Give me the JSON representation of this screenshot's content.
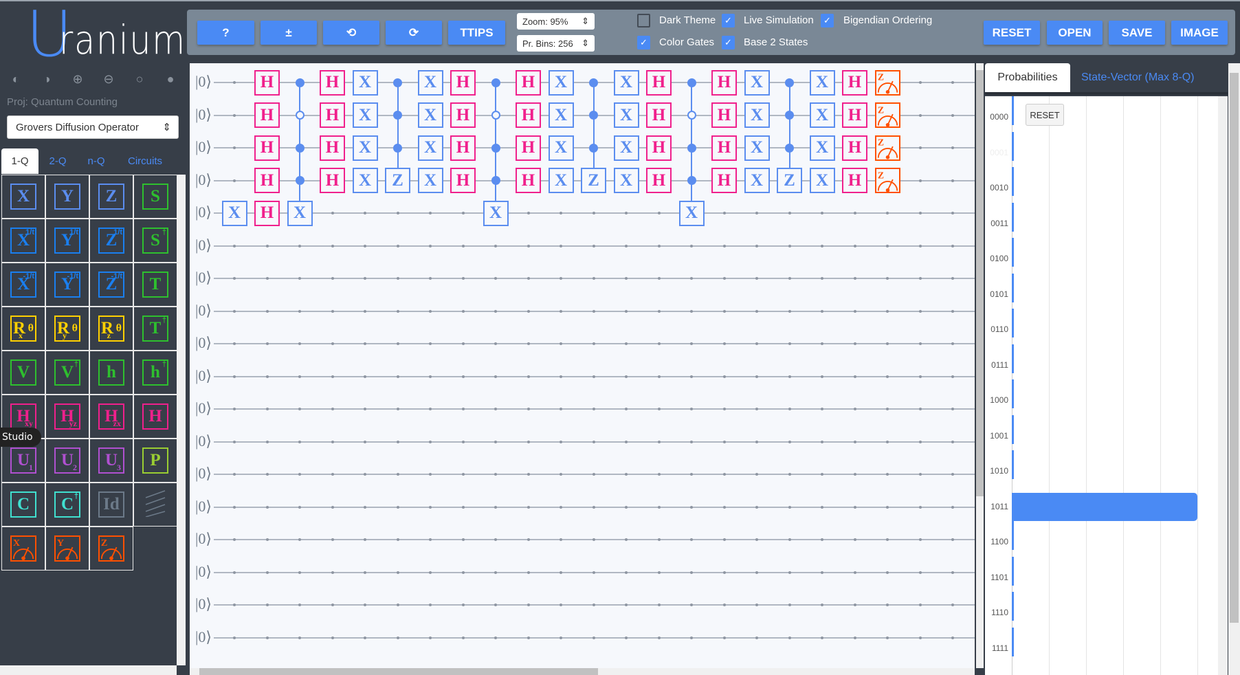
{
  "app": {
    "logo_text": "Uranium",
    "project_label": "Proj: Quantum Counting",
    "circuit_select": "Grovers Diffusion Operator",
    "tooltip": "Studio",
    "mode_icons": [
      "half-circle-left-icon",
      "half-circle-right-icon",
      "circle-plus-icon",
      "circle-minus-icon",
      "circle-empty-icon",
      "circle-filled-icon"
    ]
  },
  "sidebar": {
    "tabs": [
      {
        "label": "1-Q",
        "active": true
      },
      {
        "label": "2-Q"
      },
      {
        "label": "n-Q"
      },
      {
        "label": "Circuits"
      }
    ],
    "palette": [
      {
        "t": "X",
        "c": "#5b8def"
      },
      {
        "t": "Y",
        "c": "#5b8def"
      },
      {
        "t": "Z",
        "c": "#5b8def"
      },
      {
        "t": "S",
        "c": "#2ec02e"
      },
      {
        "t": "X",
        "sup": "1/t",
        "c": "#1a7ff0"
      },
      {
        "t": "Y",
        "sup": "1/t",
        "c": "#1a7ff0"
      },
      {
        "t": "Z",
        "sup": "1/t",
        "c": "#1a7ff0"
      },
      {
        "t": "S",
        "sup": "†",
        "c": "#2ec02e"
      },
      {
        "t": "X",
        "sup": "-1/t",
        "c": "#1a7ff0"
      },
      {
        "t": "Y",
        "sup": "-1/t",
        "c": "#1a7ff0"
      },
      {
        "t": "Z",
        "sup": "-1/t",
        "c": "#1a7ff0"
      },
      {
        "t": "T",
        "c": "#2ec02e"
      },
      {
        "t": "Rθ",
        "sub": "x",
        "c": "#ffd000"
      },
      {
        "t": "Rθ",
        "sub": "y",
        "c": "#ffd000"
      },
      {
        "t": "Rθ",
        "sub": "z",
        "c": "#ffd000"
      },
      {
        "t": "T",
        "sup": "†",
        "c": "#2ec02e"
      },
      {
        "t": "V",
        "c": "#2ec02e"
      },
      {
        "t": "V",
        "sup": "†",
        "c": "#2ec02e"
      },
      {
        "t": "h",
        "c": "#2ec02e"
      },
      {
        "t": "h",
        "sup": "†",
        "c": "#2ec02e"
      },
      {
        "t": "H",
        "sub": "xy",
        "c": "#f0208c"
      },
      {
        "t": "H",
        "sub": "yz",
        "c": "#f0208c"
      },
      {
        "t": "H",
        "sub": "zx",
        "c": "#f0208c"
      },
      {
        "t": "H",
        "c": "#f0208c"
      },
      {
        "t": "U",
        "sub": "1",
        "c": "#b050d0"
      },
      {
        "t": "U",
        "sub": "2",
        "c": "#b050d0"
      },
      {
        "t": "U",
        "sub": "3",
        "c": "#b050d0"
      },
      {
        "t": "P",
        "c": "#9acd32"
      },
      {
        "t": "C",
        "c": "#40e0d0"
      },
      {
        "t": "C",
        "sup": "†",
        "c": "#40e0d0"
      },
      {
        "t": "Id",
        "c": "#6c7a89"
      },
      {
        "icon": "barrier-icon",
        "c": "#6c7a89"
      },
      {
        "meas": "X",
        "c": "#ff5000"
      },
      {
        "meas": "Y",
        "c": "#ff5000"
      },
      {
        "meas": "Z",
        "c": "#ff5000"
      }
    ]
  },
  "toolbar": {
    "help": "?",
    "plusminus": "±",
    "undo": "⟲",
    "redo": "⟳",
    "ttips": "TTIPS",
    "zoom": "Zoom: 95%",
    "bins": "Pr. Bins: 256",
    "checks": [
      {
        "label": "Dark Theme",
        "checked": false
      },
      {
        "label": "Live Simulation",
        "checked": true
      },
      {
        "label": "Bigendian Ordering",
        "checked": true
      },
      {
        "label": "Color Gates",
        "checked": true
      },
      {
        "label": "Base 2 States",
        "checked": true
      }
    ],
    "reset": "RESET",
    "open": "OPEN",
    "save": "SAVE",
    "image": "IMAGE"
  },
  "circuit": {
    "ket": "|0⟩",
    "qubits": 18,
    "columns_total": 23,
    "colors": {
      "H": "#f0208c",
      "X": "#5b8def",
      "Z": "#5b8def",
      "M": "#ff5000"
    },
    "columns": [
      [
        null,
        null,
        null,
        null,
        "X"
      ],
      [
        "H",
        "H",
        "H",
        "H",
        "H"
      ],
      [
        "●",
        "○",
        "●",
        "●",
        "X"
      ],
      [
        "H",
        "H",
        "H",
        "H"
      ],
      [
        "X",
        "X",
        "X",
        "X"
      ],
      [
        "●",
        "●",
        "●",
        "Z"
      ],
      [
        "X",
        "X",
        "X",
        "X"
      ],
      [
        "H",
        "H",
        "H",
        "H"
      ],
      [
        "●",
        "○",
        "●",
        "●",
        "X"
      ],
      [
        "H",
        "H",
        "H",
        "H"
      ],
      [
        "X",
        "X",
        "X",
        "X"
      ],
      [
        "●",
        "●",
        "●",
        "Z"
      ],
      [
        "X",
        "X",
        "X",
        "X"
      ],
      [
        "H",
        "H",
        "H",
        "H"
      ],
      [
        "●",
        "○",
        "●",
        "●",
        "X"
      ],
      [
        "H",
        "H",
        "H",
        "H"
      ],
      [
        "X",
        "X",
        "X",
        "X"
      ],
      [
        "●",
        "●",
        "●",
        "Z"
      ],
      [
        "X",
        "X",
        "X",
        "X"
      ],
      [
        "H",
        "H",
        "H",
        "H"
      ],
      [
        "MZ",
        "MZ",
        "MZ",
        "MZ"
      ]
    ]
  },
  "results": {
    "tabs": [
      "Probabilities",
      "State-Vector (Max 8-Q)"
    ],
    "reset": "RESET",
    "chart_data": {
      "type": "bar",
      "orientation": "horizontal",
      "categories": [
        "0000",
        "0001",
        "0010",
        "0011",
        "0100",
        "0101",
        "0110",
        "0111",
        "1000",
        "1001",
        "1010",
        "1011",
        "1100",
        "1101",
        "1110",
        "1111"
      ],
      "values": [
        0,
        0,
        0,
        0,
        0,
        0,
        0,
        0,
        0,
        0,
        0,
        1.0,
        0,
        0,
        0,
        0
      ],
      "xlim": [
        0,
        1
      ],
      "grid": true
    }
  }
}
